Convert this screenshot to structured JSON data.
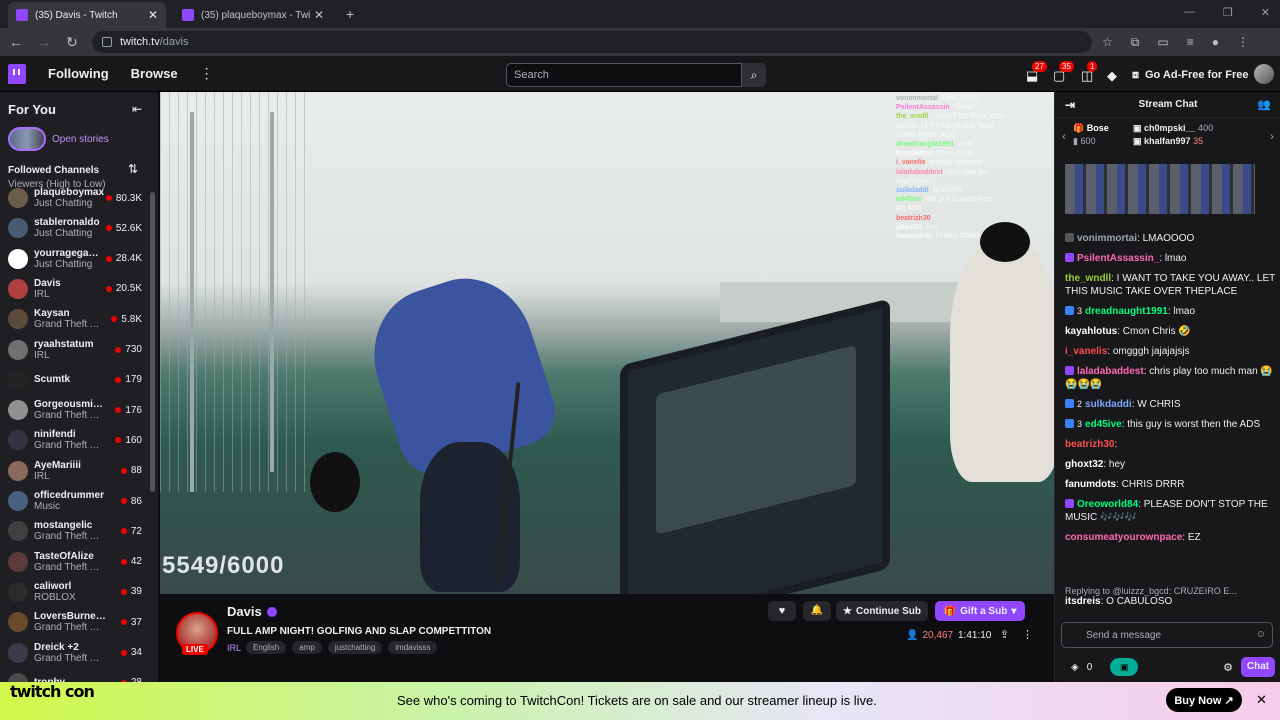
{
  "browser": {
    "tabs": [
      {
        "title": "(35) Davis - Twitch",
        "close": "✕"
      },
      {
        "title": "(35) plaqueboymax - Twitch",
        "close": "✕"
      }
    ],
    "new_tab": "+",
    "url_host": "twitch.tv",
    "url_path": "/davis"
  },
  "topnav": {
    "following": "Following",
    "browse": "Browse",
    "more": "⋮",
    "search_placeholder": "Search",
    "badges": [
      "27",
      "35",
      "1"
    ],
    "ad_free": "Go Ad-Free for Free"
  },
  "sidebar": {
    "for_you": "For You",
    "open_stories": "Open stories",
    "followed_channels": "Followed Channels",
    "sort_label": "Viewers (High to Low)",
    "channels": [
      {
        "name": "plaqueboymax",
        "sub": "Just Chatting",
        "viewers": "80.3K",
        "color": "#6b5b4b"
      },
      {
        "name": "stableronaldo",
        "sub": "Just Chatting",
        "viewers": "52.6K",
        "color": "#4a5a70"
      },
      {
        "name": "yourragegami...",
        "sub": "Just Chatting",
        "viewers": "28.4K",
        "color": "#ffffff"
      },
      {
        "name": "Davis",
        "sub": "IRL",
        "viewers": "20.5K",
        "color": "#b04040"
      },
      {
        "name": "Kaysan",
        "sub": "Grand Theft Au...",
        "viewers": "5.8K",
        "color": "#5c4a3a"
      },
      {
        "name": "ryaahstatum",
        "sub": "IRL",
        "viewers": "730",
        "color": "#707070"
      },
      {
        "name": "Scumtk",
        "sub": "",
        "viewers": "179",
        "color": "#222222"
      },
      {
        "name": "Gorgeousminaj",
        "sub": "Grand Theft Au...",
        "viewers": "176",
        "color": "#909090"
      },
      {
        "name": "ninifendi",
        "sub": "Grand Theft Au...",
        "viewers": "160",
        "color": "#333344"
      },
      {
        "name": "AyeMariiii",
        "sub": "IRL",
        "viewers": "88",
        "color": "#8a6a5a"
      },
      {
        "name": "officedrummer",
        "sub": "Music",
        "viewers": "86",
        "color": "#4a6080"
      },
      {
        "name": "mostangelic",
        "sub": "Grand Theft Au...",
        "viewers": "72",
        "color": "#404040"
      },
      {
        "name": "TasteOfAlize",
        "sub": "Grand Theft Au...",
        "viewers": "42",
        "color": "#5a3a3a"
      },
      {
        "name": "caliworl",
        "sub": "ROBLOX",
        "viewers": "39",
        "color": "#2a2a2a"
      },
      {
        "name": "LoversBurner +2",
        "sub": "Grand Theft Au...",
        "viewers": "37",
        "color": "#6a4a2a"
      },
      {
        "name": "Dreick +2",
        "sub": "Grand Theft Au...",
        "viewers": "34",
        "color": "#3a3a4a"
      },
      {
        "name": "trophy",
        "sub": "",
        "viewers": "28",
        "color": "#4a4a4a"
      }
    ]
  },
  "video": {
    "counter": "5549/6000",
    "overlay_chat": [
      {
        "u": "vonimmortal",
        "t": ": LMAOOOO",
        "c": "#9aa"
      },
      {
        "u": "PsilentAssassin_",
        "t": ": lmao",
        "c": "#ff6ad5"
      },
      {
        "u": "the_wndll",
        "t": ": I WANT TO TAKE YOU",
        "c": "#9acd32"
      },
      {
        "u": "",
        "t": "AWAY.. LET THIS MUSIC TAKE",
        "c": "#fff"
      },
      {
        "u": "",
        "t": "OVER THEPLACE",
        "c": "#fff"
      },
      {
        "u": "dreadnaught1991",
        "t": ": lmao",
        "c": "#6f6"
      },
      {
        "u": "kayahlotus",
        "t": ": Cmon Chris",
        "c": "#fff"
      },
      {
        "u": "i_vanelis",
        "t": ": omgggh jajajajsjs",
        "c": "#f55"
      },
      {
        "u": "laladabaddest",
        "t": ": chris play too",
        "c": "#f7a"
      },
      {
        "u": "",
        "t": "much man",
        "c": "#fff"
      },
      {
        "u": "sulkdaddi",
        "t": ": W CHRIS",
        "c": "#7af"
      },
      {
        "u": "ed45ive",
        "t": ": this guy is worst then",
        "c": "#6f6"
      },
      {
        "u": "",
        "t": "the ADS",
        "c": "#fff"
      },
      {
        "u": "beatrizh30",
        "t": ":",
        "c": "#f55"
      },
      {
        "u": "ghoxt32",
        "t": ": hey",
        "c": "#fff"
      },
      {
        "u": "fanumdots",
        "t": ": CHRIS DRRR",
        "c": "#fff"
      }
    ]
  },
  "stream": {
    "channel": "Davis",
    "live": "LIVE",
    "title": "FULL AMP NIGHT! GOLFING AND SLAP COMPETTITON",
    "category": "IRL",
    "tags": [
      "English",
      "amp",
      "justchatting",
      "imdavisss"
    ],
    "continue_sub": "Continue Sub",
    "gift_sub": "Gift a Sub",
    "viewers": "20,467",
    "uptime": "1:41:10"
  },
  "chat": {
    "header": "Stream Chat",
    "gifters": [
      {
        "name": "Bose",
        "count": "600"
      },
      {
        "name": "ch0mpski__",
        "count": "400"
      },
      {
        "name": "khalfan997",
        "count": "35"
      }
    ],
    "messages": [
      {
        "user": "vonimmortai",
        "text": ": LMAOOOO",
        "color": "#9aa7b0",
        "badge": "",
        "badge_color": "#555"
      },
      {
        "user": "PsilentAssassin_",
        "text": ": lmao",
        "color": "#ff69b4",
        "badge": "",
        "badge_color": "#9146ff"
      },
      {
        "user": "the_wndll",
        "text": ": I WANT TO TAKE YOU AWAY.. LET THIS MUSIC TAKE OVER THEPLACE",
        "color": "#9acd32",
        "badge": "",
        "badge_color": ""
      },
      {
        "user": "dreadnaught1991",
        "text": ": lmao",
        "color": "#00ff7f",
        "badge": "3",
        "badge_color": "#3b82f6"
      },
      {
        "user": "kayahlotus",
        "text": ": Cmon Chris 🤣",
        "color": "#ffffff",
        "badge": "",
        "badge_color": ""
      },
      {
        "user": "i_vanelis",
        "text": ": omgggh jajajajsjs",
        "color": "#ff4d4d",
        "badge": "",
        "badge_color": ""
      },
      {
        "user": "laladabaddest",
        "text": ": chris play too much man 😭😭😭😭",
        "color": "#ff69b4",
        "badge": "",
        "badge_color": "#9146ff"
      },
      {
        "user": "sulkdaddi",
        "text": ": W CHRIS",
        "color": "#7aa7ff",
        "badge": "2",
        "badge_color": "#3b82f6"
      },
      {
        "user": "ed45ive",
        "text": ": this guy is worst then the ADS",
        "color": "#00ff7f",
        "badge": "3",
        "badge_color": "#3b82f6"
      },
      {
        "user": "beatrizh30",
        "text": ":",
        "color": "#ff4d4d",
        "badge": "",
        "badge_color": ""
      },
      {
        "user": "ghoxt32",
        "text": ": hey",
        "color": "#ffffff",
        "badge": "",
        "badge_color": ""
      },
      {
        "user": "fanumdots",
        "text": ": CHRIS DRRR",
        "color": "#ffffff",
        "badge": "",
        "badge_color": ""
      },
      {
        "user": "Oreoworld84",
        "text": ": PLEASE DON'T STOP THE MUSIC 🎶🎶🎶",
        "color": "#00ff7f",
        "badge": "",
        "badge_color": "#9146ff"
      },
      {
        "user": "consumeatyourownpace",
        "text": ": EZ",
        "color": "#ff69b4",
        "badge": "",
        "badge_color": ""
      }
    ],
    "replying": "Replying to @luizzz_bgcd: CRUZEIRO E...",
    "reply_msg": {
      "user": "itsdreis",
      "text": ": O CABULOSO"
    },
    "input_placeholder": "Send a message",
    "points": "0",
    "chat_button": "Chat"
  },
  "banner": {
    "logo": "twitch con",
    "text": "See who's coming to TwitchCon! Tickets are on sale and our streamer lineup is live.",
    "buy_now": "Buy Now ↗",
    "close": "✕"
  }
}
